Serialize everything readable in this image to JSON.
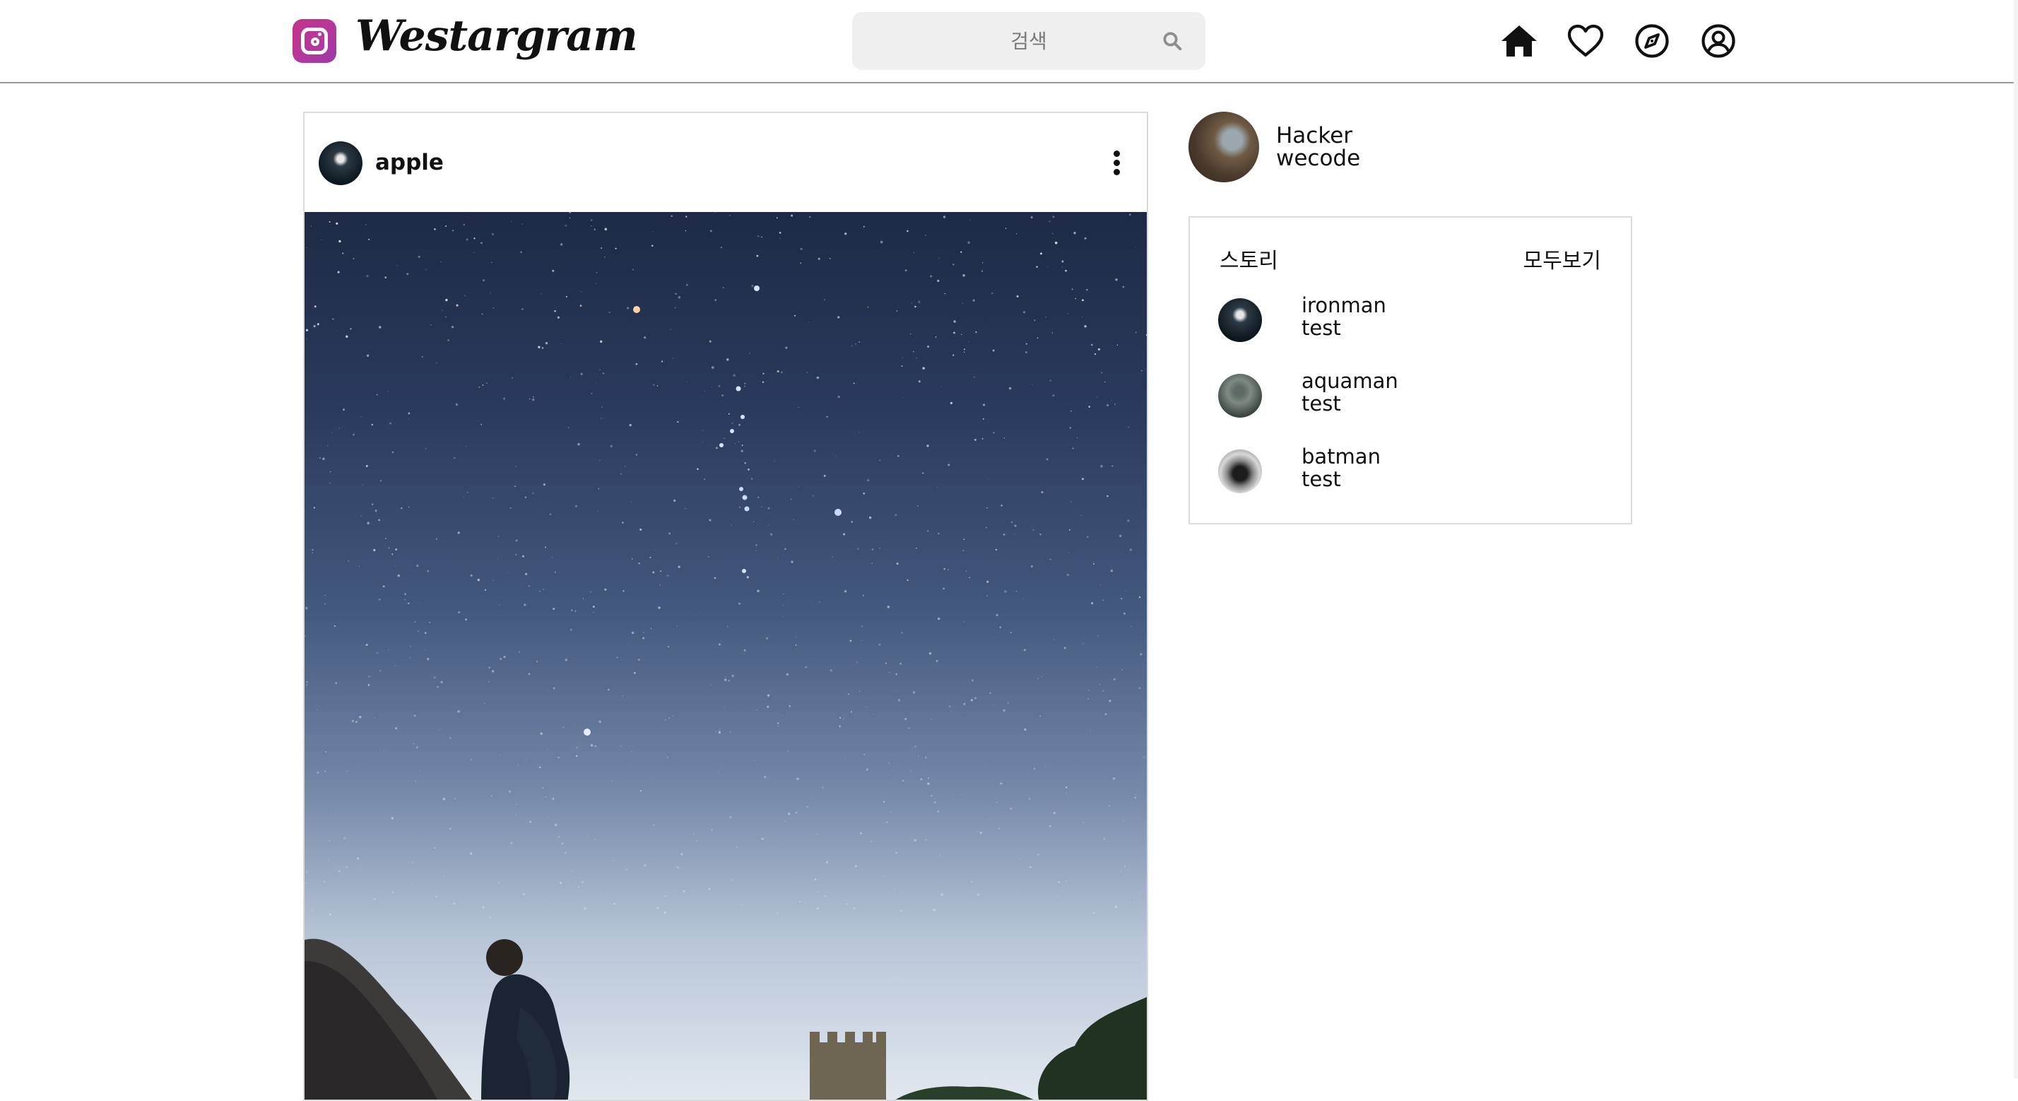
{
  "header": {
    "brand": "Westargram",
    "search_placeholder": "검색"
  },
  "nav": {
    "icons": [
      "home-icon",
      "heart-icon",
      "compass-icon",
      "user-circle-icon"
    ]
  },
  "post": {
    "username": "apple"
  },
  "profile": {
    "name": "Hacker",
    "subtitle": "wecode"
  },
  "stories": {
    "title": "스토리",
    "see_all": "모두보기",
    "items": [
      {
        "name": "ironman",
        "subtitle": "test"
      },
      {
        "name": "aquaman",
        "subtitle": "test"
      },
      {
        "name": "batman",
        "subtitle": "test"
      }
    ]
  },
  "colors": {
    "brand_gradient": [
      "#c13584",
      "#9b3aa8"
    ],
    "border": "#dbdbdb",
    "search_bg": "#efefef"
  }
}
